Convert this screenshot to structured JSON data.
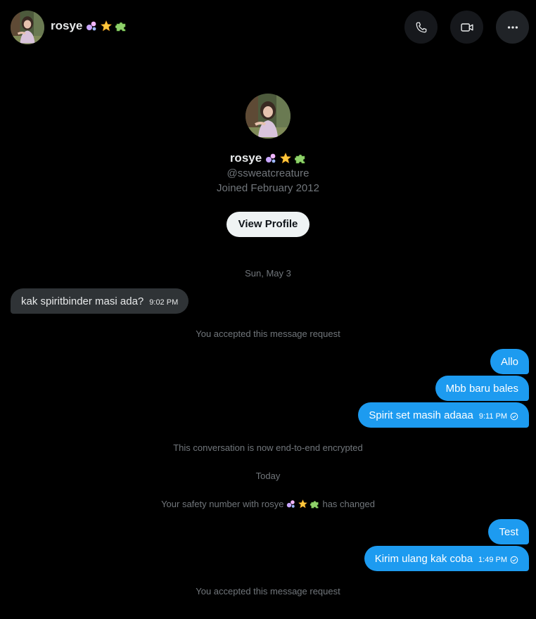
{
  "header": {
    "name": "rosye"
  },
  "profile": {
    "name": "rosye",
    "handle": "@ssweatcreature",
    "joined": "Joined February 2012",
    "view_button": "View Profile"
  },
  "emoji_names": [
    "bubbles",
    "star",
    "puzzle-piece"
  ],
  "messages": {
    "date1": "Sun, May 3",
    "m1": {
      "text": "kak spiritbinder masi ada?",
      "time": "9:02 PM"
    },
    "accepted1": "You accepted this message request",
    "m2": {
      "text": "Allo"
    },
    "m3": {
      "text": "Mbb baru bales"
    },
    "m4": {
      "text": "Spirit set masih adaaa",
      "time": "9:11 PM"
    },
    "encrypted": "This conversation is now end-to-end encrypted",
    "date2": "Today",
    "safety_prefix": "Your safety number with rosye",
    "safety_suffix": "has changed",
    "m5": {
      "text": "Test"
    },
    "m6": {
      "text": "Kirim ulang kak coba",
      "time": "1:49 PM"
    },
    "accepted2": "You accepted this message request"
  },
  "colors": {
    "background": "#000000",
    "outgoing_bubble": "#1d9bf0",
    "incoming_bubble": "#2f3336",
    "muted_text": "#71767b"
  }
}
